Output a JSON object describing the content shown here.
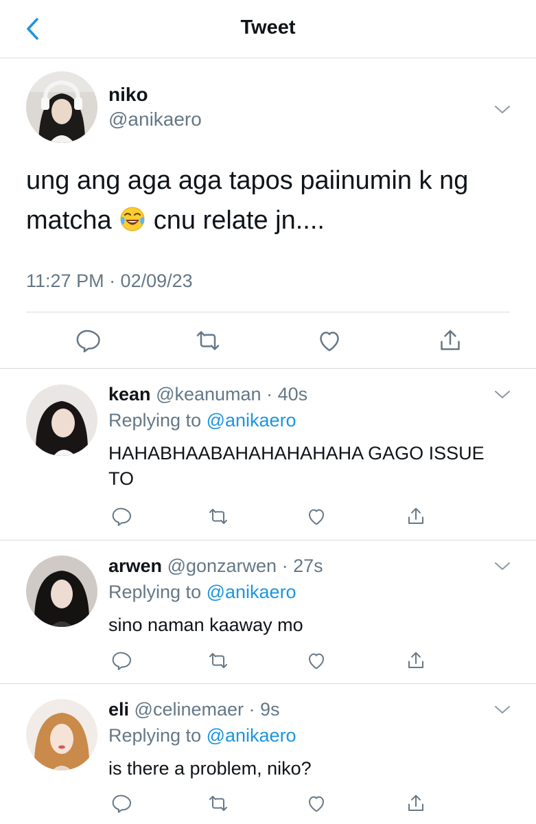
{
  "header": {
    "title": "Tweet",
    "back_icon": "chevron-left-icon"
  },
  "colors": {
    "accent": "#1b95e0",
    "secondary_text": "#657786",
    "divider": "#d6dbe0"
  },
  "main_tweet": {
    "name": "niko",
    "handle": "@anikaero",
    "text_before_emoji": "ung ang aga aga tapos paiinumin k ng matcha ",
    "emoji": "face-with-tears-of-joy",
    "text_after_emoji": " cnu relate jn....",
    "timestamp": "11:27 PM · 02/09/23"
  },
  "replies": [
    {
      "name": "kean",
      "handle": "@keanuman",
      "time": "40s",
      "replying_prefix": "Replying to ",
      "replying_to": "@anikaero",
      "text": "HAHABHAABAHAHAHAHAHA GAGO ISSUE TO"
    },
    {
      "name": "arwen",
      "handle": "@gonzarwen",
      "time": "27s",
      "replying_prefix": "Replying to ",
      "replying_to": "@anikaero",
      "text": "sino naman kaaway mo"
    },
    {
      "name": "eli",
      "handle": "@celinemaer",
      "time": "9s",
      "replying_prefix": "Replying to ",
      "replying_to": "@anikaero",
      "text": "is there a problem, niko?"
    }
  ],
  "actions": [
    "reply-icon",
    "retweet-icon",
    "like-icon",
    "share-icon"
  ]
}
